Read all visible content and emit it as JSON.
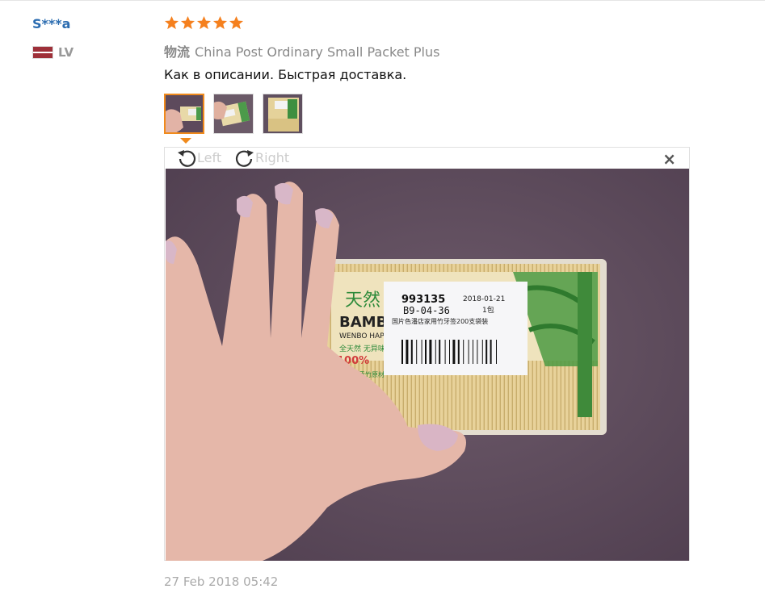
{
  "review": {
    "user": {
      "name": "S***a",
      "country_code": "LV"
    },
    "rating": 5,
    "shipping_label": "物流",
    "shipping_method": "China Post Ordinary Small Packet Plus",
    "text": "Как в описании. Быстрая доставка.",
    "date": "27 Feb 2018 05:42"
  },
  "colors": {
    "username": "#2b6cb0",
    "star": "#f5801e",
    "thumb_active_border": "#f08a1c"
  },
  "viewer": {
    "rotate_left_label": "Left",
    "rotate_right_label": "Right",
    "close_symbol": "×"
  },
  "photo": {
    "label_code": "993135",
    "label_date": "2018-01-21",
    "label_location": "B9-04-36",
    "label_count": "1包",
    "label_desc": "国片色潘店家用竹牙签200支袋装",
    "pack_brand": "BAMBO",
    "pack_cn": "天然",
    "pack_sub": "WENBO HAPI",
    "pack_line1": "全天然 无异味",
    "pack_percent": "100%",
    "pack_line2": "精选优质竹原材"
  }
}
